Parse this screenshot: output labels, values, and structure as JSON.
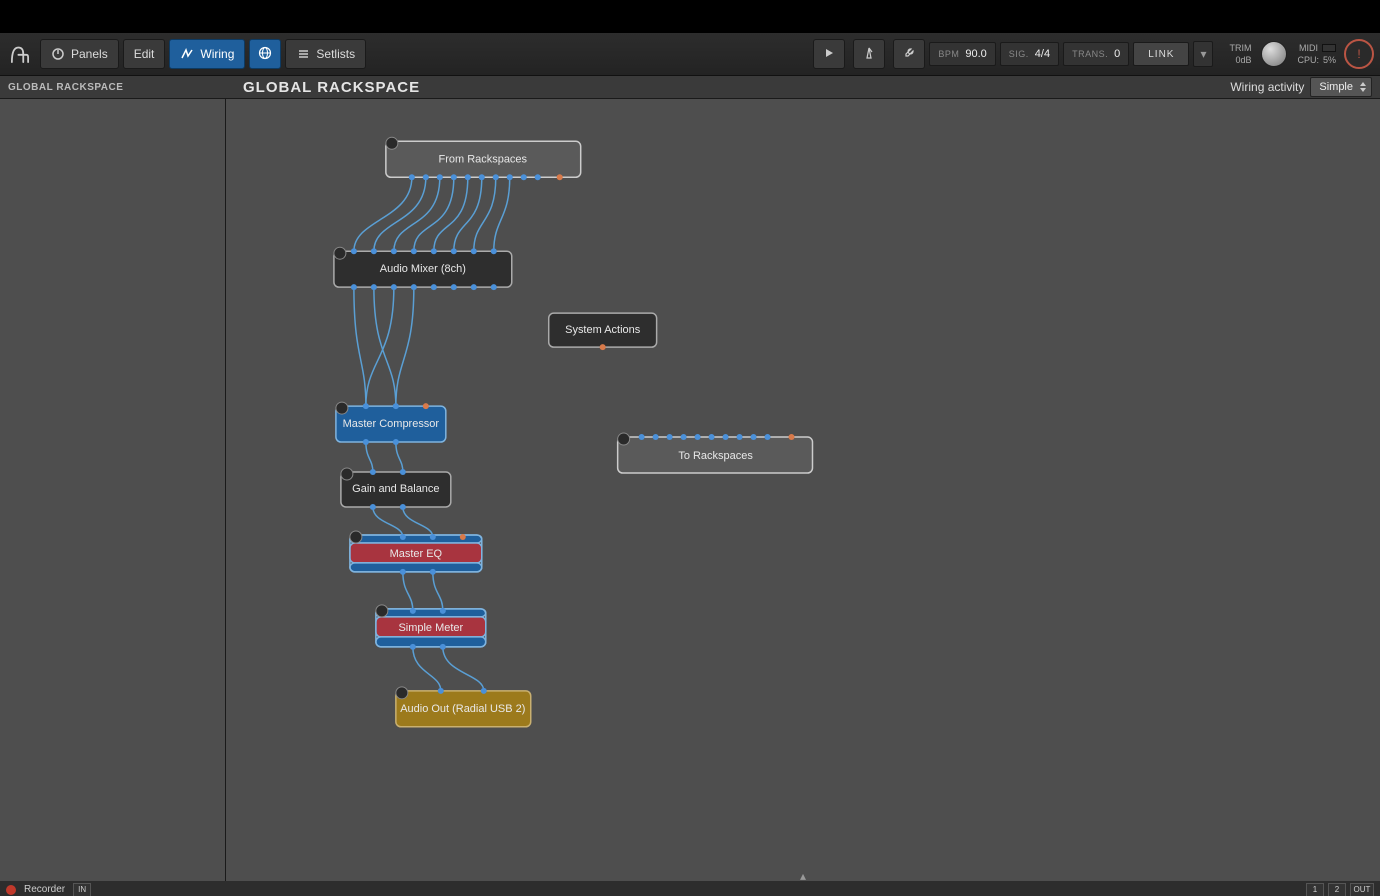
{
  "toolbar": {
    "panels_label": "Panels",
    "edit_label": "Edit",
    "wiring_label": "Wiring",
    "setlists_label": "Setlists"
  },
  "transport": {
    "bpm_label": "BPM",
    "bpm_value": "90.0",
    "sig_label": "SIG.",
    "sig_value": "4/4",
    "trans_label": "TRANS.",
    "trans_value": "0",
    "link_label": "LINK"
  },
  "status": {
    "trim_label": "TRIM",
    "trim_value": "0dB",
    "midi_label": "MIDI",
    "cpu_label": "CPU:",
    "cpu_value": "5%"
  },
  "sidebar": {
    "tab_label": "GLOBAL RACKSPACE"
  },
  "main": {
    "title": "GLOBAL RACKSPACE",
    "wiring_activity_label": "Wiring activity",
    "wiring_activity_value": "Simple"
  },
  "nodes": {
    "from_rackspaces": "From Rackspaces",
    "audio_mixer": "Audio Mixer (8ch)",
    "system_actions": "System Actions",
    "master_compressor": "Master Compressor",
    "gain_balance": "Gain and Balance",
    "to_rackspaces": "To Rackspaces",
    "master_eq": "Master EQ",
    "simple_meter": "Simple Meter",
    "audio_out": "Audio Out (Radial USB 2)"
  },
  "footer": {
    "recorder_label": "Recorder",
    "in_label": "IN",
    "out_label": "OUT",
    "ch1": "1",
    "ch2": "2"
  }
}
